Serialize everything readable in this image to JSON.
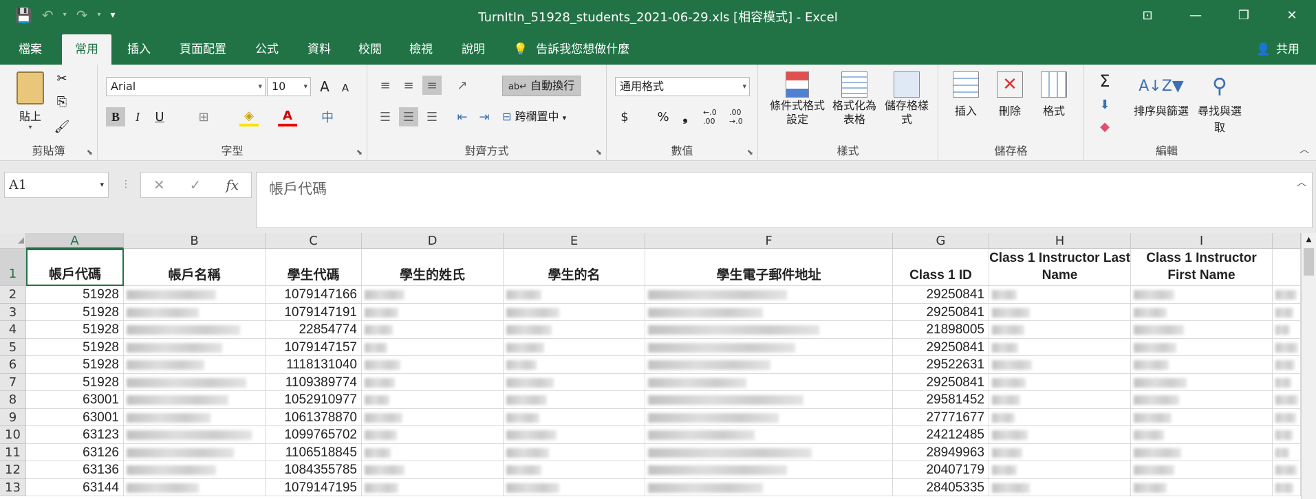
{
  "titlebar": {
    "title": "TurnItIn_51928_students_2021-06-29.xls [相容模式] - Excel",
    "save_icon": "💾",
    "undo_icon": "↶",
    "redo_icon": "↷",
    "customize_icon": "▾",
    "ribbon_display_icon": "⊡",
    "minimize_icon": "—",
    "restore_icon": "❐",
    "close_icon": "✕"
  },
  "tabs": [
    "檔案",
    "常用",
    "插入",
    "頁面配置",
    "公式",
    "資料",
    "校閱",
    "檢視",
    "說明"
  ],
  "tellme": {
    "icon": "💡",
    "label": "告訴我您想做什麼"
  },
  "share": {
    "icon": "👤",
    "label": "共用"
  },
  "ribbon": {
    "clipboard": {
      "label": "剪貼簿",
      "paste": "貼上",
      "cut_icon": "✂",
      "copy_icon": "⎘",
      "painter_icon": "🖌"
    },
    "font": {
      "label": "字型",
      "font_name": "Arial",
      "font_size": "10",
      "grow": "A",
      "shrink": "A",
      "bold": "B",
      "italic": "I",
      "underline": "U",
      "border_icon": "⊞",
      "fill_icon": "◈",
      "color_icon": "A",
      "phonetic": "中"
    },
    "alignment": {
      "label": "對齊方式",
      "wrap": "自動換行",
      "merge": "跨欄置中"
    },
    "number": {
      "label": "數值",
      "format": "通用格式",
      "currency": "$",
      "percent": "%",
      "comma": "❟",
      "inc_dec": "←.0 .00",
      "dec_dec": ".00 →.0"
    },
    "styles": {
      "label": "樣式",
      "conditional": "條件式格式設定",
      "table": "格式化為表格",
      "cell_styles": "儲存格樣式"
    },
    "cells": {
      "label": "儲存格",
      "insert": "插入",
      "delete": "刪除",
      "format": "格式"
    },
    "editing": {
      "label": "編輯",
      "sum_icon": "Σ",
      "fill_icon": "⬇",
      "clear_icon": "◆",
      "sort": "排序與篩選",
      "find": "尋找與選取"
    }
  },
  "formula_bar": {
    "name_box": "A1",
    "cancel_icon": "✕",
    "enter_icon": "✓",
    "fx": "fx",
    "content": "帳戶代碼"
  },
  "columns": [
    "A",
    "B",
    "C",
    "D",
    "E",
    "F",
    "G",
    "H",
    "I"
  ],
  "header_row": {
    "num": "1",
    "cells": [
      "帳戶代碼",
      "帳戶名稱",
      "學生代碼",
      "學生的姓氏",
      "學生的名",
      "學生電子郵件地址",
      "Class 1 ID",
      "Class 1 Instructor Last Name",
      "Class 1 Instructor First Name"
    ]
  },
  "rows": [
    {
      "num": "2",
      "a": "51928",
      "c": "1079147166",
      "g": "29250841"
    },
    {
      "num": "3",
      "a": "51928",
      "c": "1079147191",
      "g": "29250841"
    },
    {
      "num": "4",
      "a": "51928",
      "c": "22854774",
      "g": "21898005"
    },
    {
      "num": "5",
      "a": "51928",
      "c": "1079147157",
      "g": "29250841"
    },
    {
      "num": "6",
      "a": "51928",
      "c": "1118131040",
      "g": "29522631"
    },
    {
      "num": "7",
      "a": "51928",
      "c": "1109389774",
      "g": "29250841"
    },
    {
      "num": "8",
      "a": "63001",
      "c": "1052910977",
      "g": "29581452"
    },
    {
      "num": "9",
      "a": "63001",
      "c": "1061378870",
      "g": "27771677"
    },
    {
      "num": "10",
      "a": "63123",
      "c": "1099765702",
      "g": "24212485"
    },
    {
      "num": "11",
      "a": "63126",
      "c": "1106518845",
      "g": "28949963"
    },
    {
      "num": "12",
      "a": "63136",
      "c": "1084355785",
      "g": "20407179"
    },
    {
      "num": "13",
      "a": "63144",
      "c": "1079147195",
      "g": "28405335"
    }
  ]
}
